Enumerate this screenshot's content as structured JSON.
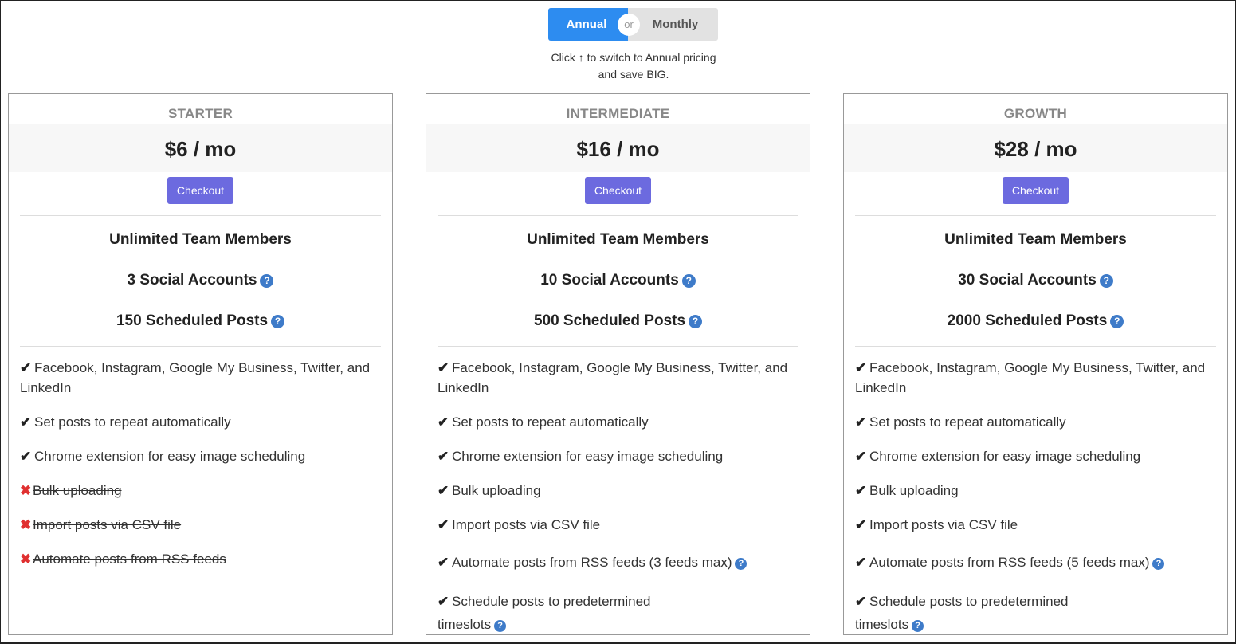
{
  "toggle": {
    "annual": "Annual",
    "or": "or",
    "monthly": "Monthly"
  },
  "hint": {
    "before": "Click",
    "arrow": "↑",
    "after": "to switch to Annual pricing",
    "line2": "and save BIG."
  },
  "plans": [
    {
      "name": "STARTER",
      "price": "$6 / mo",
      "checkout": "Checkout",
      "stats": [
        "Unlimited Team Members",
        "3 Social Accounts",
        "150 Scheduled Posts"
      ],
      "features": [
        "Facebook, Instagram, Google My Business, Twitter, and LinkedIn",
        "Set posts to repeat automatically",
        "Chrome extension for easy image scheduling",
        "Bulk uploading",
        "Import posts via CSV file",
        "Automate posts from RSS feeds"
      ]
    },
    {
      "name": "INTERMEDIATE",
      "price": "$16 / mo",
      "checkout": "Checkout",
      "stats": [
        "Unlimited Team Members",
        "10 Social Accounts",
        "500 Scheduled Posts"
      ],
      "features": [
        "Facebook, Instagram, Google My Business, Twitter, and LinkedIn",
        "Set posts to repeat automatically",
        "Chrome extension for easy image scheduling",
        "Bulk uploading",
        "Import posts via CSV file",
        "Automate posts from RSS feeds (3 feeds max)",
        "Schedule posts to predetermined",
        "timeslots"
      ]
    },
    {
      "name": "GROWTH",
      "price": "$28 / mo",
      "checkout": "Checkout",
      "stats": [
        "Unlimited Team Members",
        "30 Social Accounts",
        "2000 Scheduled Posts"
      ],
      "features": [
        "Facebook, Instagram, Google My Business, Twitter, and LinkedIn",
        "Set posts to repeat automatically",
        "Chrome extension for easy image scheduling",
        "Bulk uploading",
        "Import posts via CSV file",
        "Automate posts from RSS feeds (5 feeds max)",
        "Schedule posts to predetermined",
        "timeslots"
      ]
    }
  ],
  "icons": {
    "check": "check-icon",
    "cross": "cross-icon",
    "help": "question-circle-icon",
    "arrow": "arrow-up-icon"
  },
  "colors": {
    "annual": "#2d8cf0",
    "monthly": "#e2e2e2",
    "checkout": "#6c6adf",
    "help": "#3e7bc9",
    "cross": "#e03030"
  }
}
